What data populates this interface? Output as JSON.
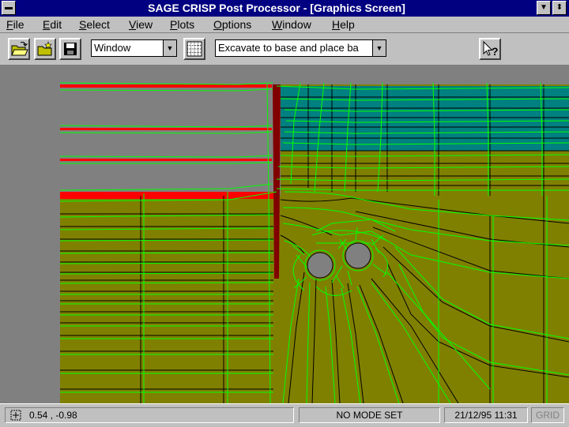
{
  "window": {
    "title": "SAGE CRISP Post Processor - [Graphics Screen]",
    "system_menu_glyph": "▬",
    "minimize_glyph": "▼",
    "restore_glyph": "⬍"
  },
  "menu": {
    "items": [
      {
        "label": "File",
        "accel": "F"
      },
      {
        "label": "Edit",
        "accel": "E"
      },
      {
        "label": "Select",
        "accel": "S"
      },
      {
        "label": "View",
        "accel": "V"
      },
      {
        "label": "Plots",
        "accel": "P"
      },
      {
        "label": "Options",
        "accel": "O"
      },
      {
        "label": "Window",
        "accel": "W"
      },
      {
        "label": "Help",
        "accel": "H"
      }
    ]
  },
  "toolbar": {
    "view_combo": {
      "value": "Window"
    },
    "stage_combo": {
      "value": "Excavate to base and place ba"
    },
    "combo_arrow": "▼",
    "help_glyph": "?"
  },
  "status": {
    "coordinates": "0.54 , -0.98",
    "mode": "NO MODE SET",
    "datetime": "21/12/95 11:31",
    "grid": "GRID"
  },
  "colors": {
    "titlebar": "#000080",
    "background": "#808080",
    "soil": "#808000",
    "upper_soil": "#008080",
    "wall": "#800000",
    "prop": "#ff0000",
    "mesh_deformed": "#00ff00",
    "mesh_original": "#000000",
    "tunnel": "#808080"
  }
}
